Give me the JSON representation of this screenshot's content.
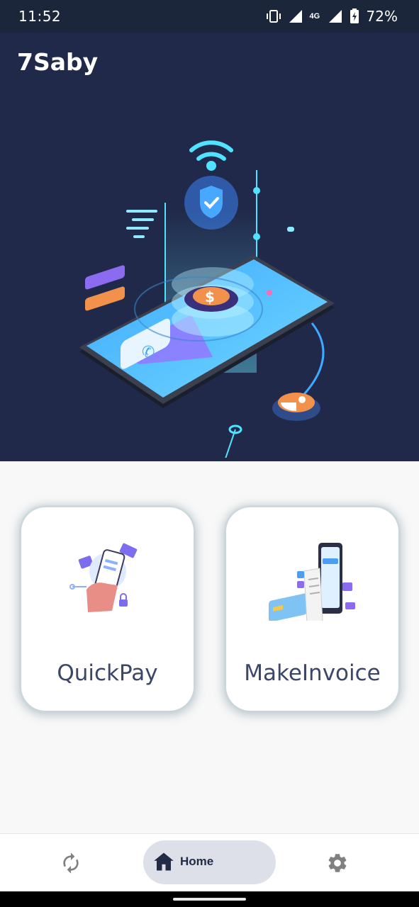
{
  "status": {
    "time": "11:52",
    "network": "4G",
    "battery": "72%",
    "icons": [
      "vibrate-icon",
      "signal-icon",
      "network-4g-icon",
      "signal-icon",
      "battery-charging-icon"
    ]
  },
  "app": {
    "title": "7Saby"
  },
  "cards": [
    {
      "label": "QuickPay",
      "icon": "quickpay-illustration"
    },
    {
      "label": "MakeInvoice",
      "icon": "invoice-illustration"
    }
  ],
  "nav": {
    "home_label": "Home",
    "items": [
      "refresh-icon",
      "home-icon",
      "settings-icon"
    ]
  },
  "colors": {
    "header_bg": "#20294a",
    "status_bg": "#1b263b",
    "label_text": "#3b4668",
    "home_pill": "#dde0e8"
  }
}
